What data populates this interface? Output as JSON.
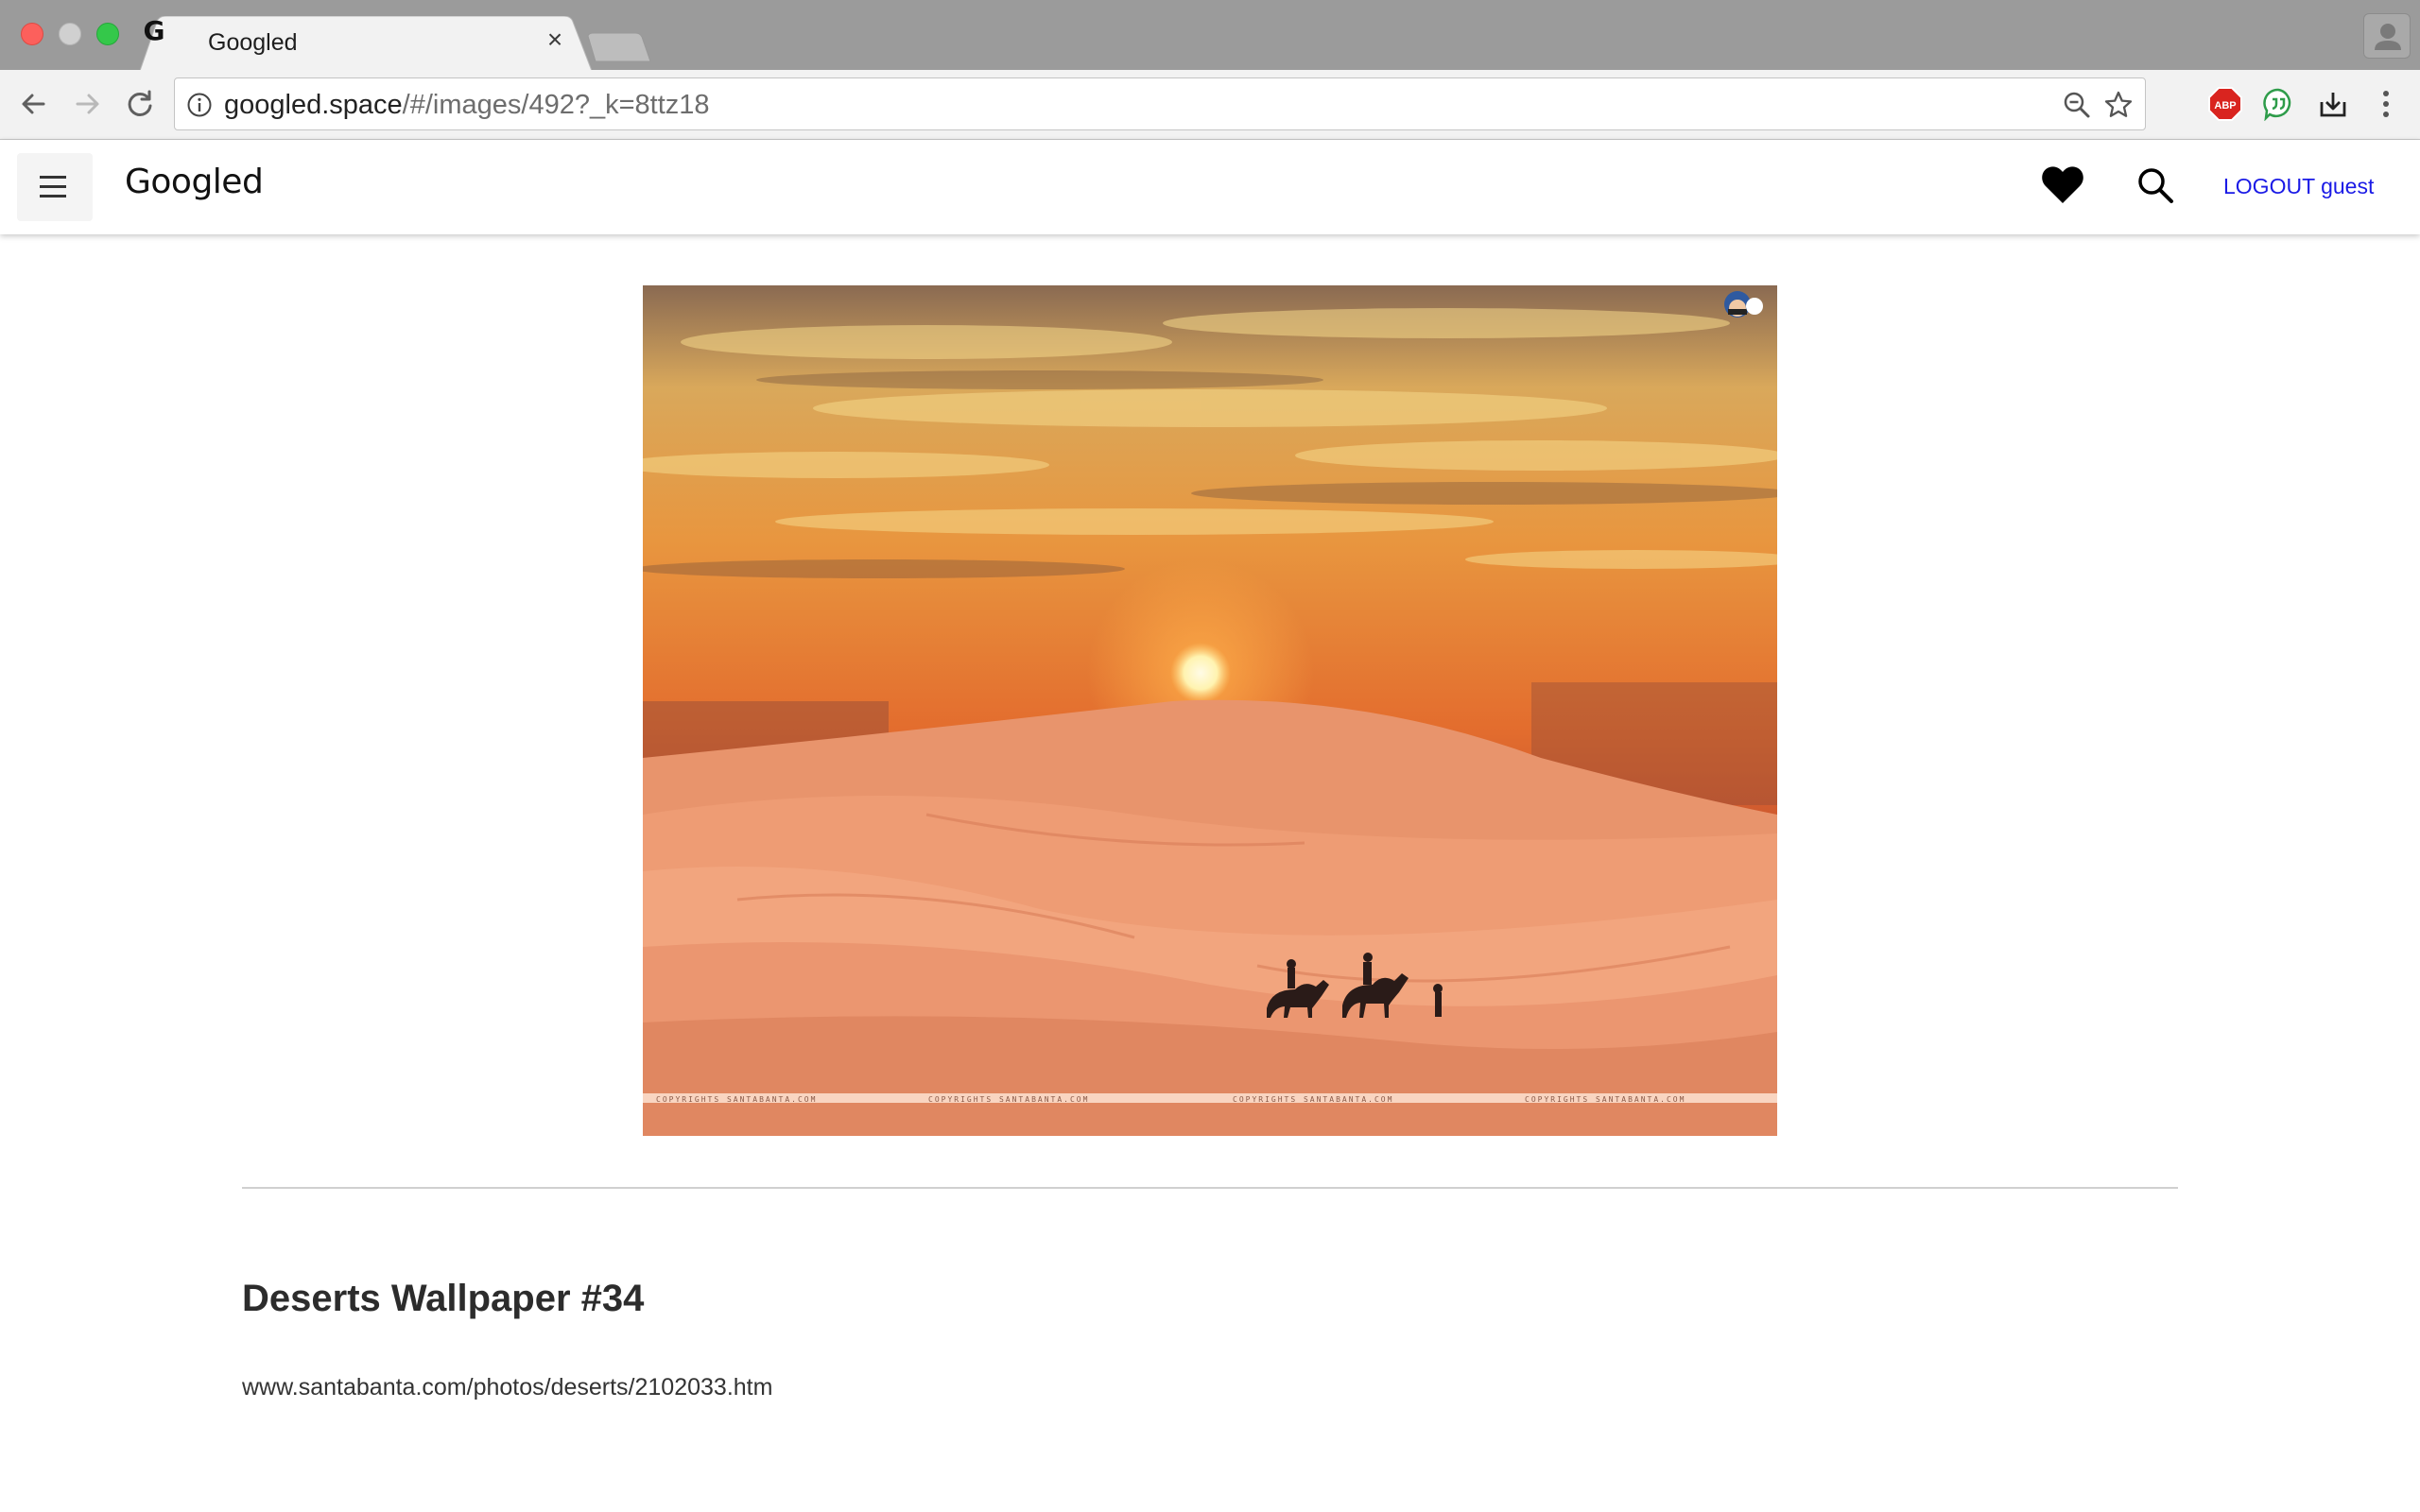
{
  "browser": {
    "tab_title": "Googled",
    "url_host": "googled.space",
    "url_path": "/#/images/492?_k=8ttz18",
    "extensions": [
      "abp-icon",
      "quote-icon",
      "download-icon"
    ],
    "abp_label": "ABP"
  },
  "app": {
    "brand": "Googled",
    "logout_label": "LOGOUT guest",
    "link_color": "#1a1ae6"
  },
  "image": {
    "title": "Deserts Wallpaper #34",
    "source": "www.santabanta.com/photos/deserts/2102033.htm",
    "watermark": "COPYRIGHTS SANTABANTA.COM"
  }
}
